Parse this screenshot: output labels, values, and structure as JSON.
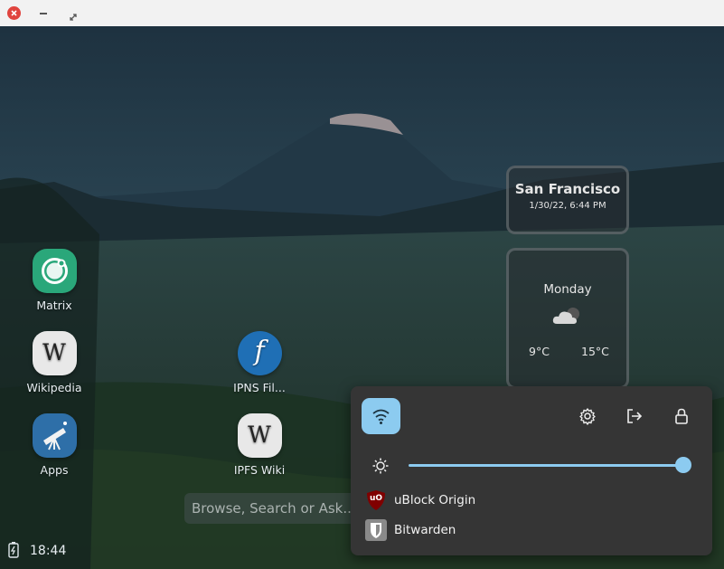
{
  "window": {
    "close_icon": "close-icon",
    "minimize_icon": "minimize-icon",
    "maximize_icon": "maximize-icon"
  },
  "desktop": {
    "apps": [
      {
        "label": "Matrix",
        "icon": "matrix-icon"
      },
      {
        "label": "Wikipedia",
        "icon": "wikipedia-icon"
      },
      {
        "label": "Apps",
        "icon": "telescope-icon"
      },
      {
        "label": "IPNS Fil...",
        "icon": "filecoin-icon"
      },
      {
        "label": "IPFS Wiki",
        "icon": "wikipedia-icon"
      }
    ],
    "wiki_glyph": "W",
    "filecoin_glyph": "f"
  },
  "widgets": {
    "clock": {
      "city": "San Francisco",
      "datetime": "1/30/22, 6:44 PM"
    },
    "weather": {
      "day": "Monday",
      "icon": "cloudy-icon",
      "low": "9°C",
      "high": "15°C"
    }
  },
  "search": {
    "placeholder": "Browse, Search or Ask..."
  },
  "statusbar": {
    "time": "18:44",
    "battery_icon": "battery-charging-icon"
  },
  "quick_panel": {
    "wifi_icon": "wifi-icon",
    "settings_icon": "gear-icon",
    "logout_icon": "logout-icon",
    "lock_icon": "lock-icon",
    "brightness_icon": "brightness-icon",
    "brightness": 1.0,
    "extensions": [
      {
        "label": "uBlock Origin",
        "icon": "ublock-origin-icon",
        "glyph": "uO"
      },
      {
        "label": "Bitwarden",
        "icon": "bitwarden-icon"
      }
    ]
  },
  "colors": {
    "accent": "#8ccbf0",
    "panel_bg": "#353535",
    "close_red": "#e0443e"
  }
}
